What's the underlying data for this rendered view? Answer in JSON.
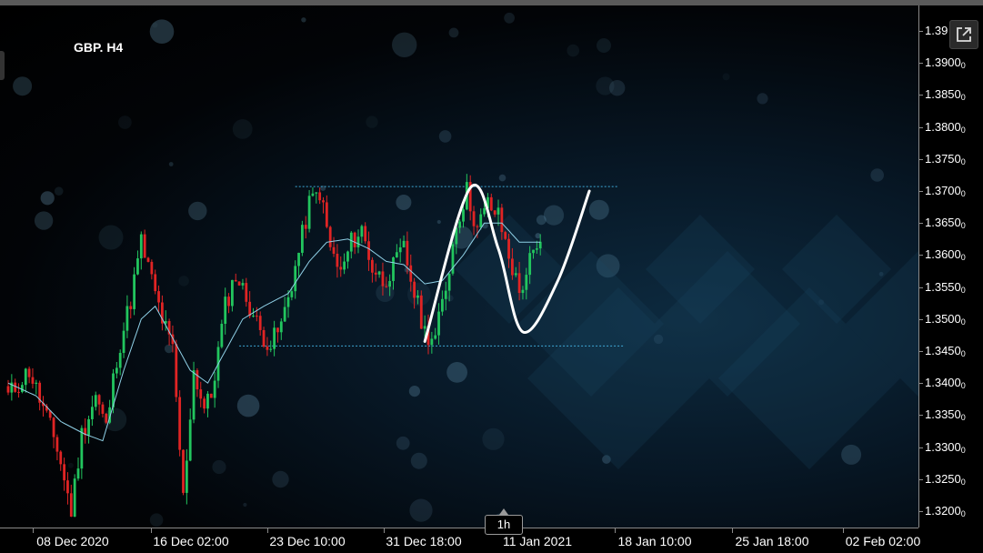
{
  "chart_data": {
    "type": "candlestick",
    "title": "GBP. H4",
    "timeframe": "1h",
    "ylim": [
      1.318,
      1.394
    ],
    "y_ticks": [
      1.395,
      1.39,
      1.385,
      1.38,
      1.375,
      1.37,
      1.365,
      1.36,
      1.355,
      1.35,
      1.345,
      1.34,
      1.335,
      1.33,
      1.325,
      1.32
    ],
    "y_tick_labels": [
      "1.39",
      "1.3900",
      "1.3850",
      "1.3800",
      "1.3750",
      "1.3700",
      "1.3650",
      "1.3600",
      "1.3550",
      "1.3500",
      "1.3450",
      "1.3400",
      "1.3350",
      "1.3300",
      "1.3250",
      "1.3200"
    ],
    "y_tick_suffix": "0",
    "x_tick_labels": [
      "08 Dec 2020",
      "16 Dec 02:00",
      "23 Dec 10:00",
      "31 Dec 18:00",
      "11 Jan 2021",
      "18 Jan 10:00",
      "25 Jan 18:00",
      "02 Feb 02:00"
    ],
    "bar_count": 164,
    "series": [
      {
        "name": "",
        "ohlc_anchors": [
          [
            0,
            1.338
          ],
          [
            6,
            1.342
          ],
          [
            10,
            1.336
          ],
          [
            14,
            1.33
          ],
          [
            18,
            1.32
          ],
          [
            21,
            1.332
          ],
          [
            25,
            1.338
          ],
          [
            28,
            1.333
          ],
          [
            31,
            1.344
          ],
          [
            35,
            1.353
          ],
          [
            38,
            1.362
          ],
          [
            41,
            1.356
          ],
          [
            44,
            1.35
          ],
          [
            47,
            1.345
          ],
          [
            50,
            1.322
          ],
          [
            53,
            1.342
          ],
          [
            56,
            1.336
          ],
          [
            58,
            1.338
          ],
          [
            62,
            1.352
          ],
          [
            65,
            1.357
          ],
          [
            69,
            1.352
          ],
          [
            72,
            1.348
          ],
          [
            75,
            1.346
          ],
          [
            78,
            1.349
          ],
          [
            82,
            1.358
          ],
          [
            86,
            1.368
          ],
          [
            89,
            1.37
          ],
          [
            92,
            1.361
          ],
          [
            95,
            1.357
          ],
          [
            98,
            1.362
          ],
          [
            101,
            1.364
          ],
          [
            104,
            1.358
          ],
          [
            107,
            1.356
          ],
          [
            110,
            1.358
          ],
          [
            113,
            1.361
          ],
          [
            116,
            1.354
          ],
          [
            119,
            1.348
          ],
          [
            122,
            1.347
          ],
          [
            125,
            1.355
          ],
          [
            128,
            1.365
          ],
          [
            131,
            1.37
          ],
          [
            134,
            1.364
          ],
          [
            137,
            1.368
          ],
          [
            140,
            1.366
          ],
          [
            143,
            1.36
          ],
          [
            146,
            1.354
          ],
          [
            149,
            1.359
          ],
          [
            152,
            1.361
          ]
        ],
        "moving_average_anchors": [
          [
            0,
            1.34
          ],
          [
            8,
            1.338
          ],
          [
            15,
            1.334
          ],
          [
            22,
            1.332
          ],
          [
            27,
            1.331
          ],
          [
            33,
            1.342
          ],
          [
            38,
            1.35
          ],
          [
            42,
            1.352
          ],
          [
            47,
            1.347
          ],
          [
            52,
            1.342
          ],
          [
            57,
            1.34
          ],
          [
            62,
            1.345
          ],
          [
            67,
            1.35
          ],
          [
            73,
            1.352
          ],
          [
            80,
            1.354
          ],
          [
            86,
            1.359
          ],
          [
            91,
            1.362
          ],
          [
            97,
            1.3625
          ],
          [
            103,
            1.361
          ],
          [
            108,
            1.359
          ],
          [
            113,
            1.3585
          ],
          [
            119,
            1.3555
          ],
          [
            124,
            1.356
          ],
          [
            130,
            1.36
          ],
          [
            136,
            1.365
          ],
          [
            141,
            1.365
          ],
          [
            146,
            1.362
          ],
          [
            152,
            1.362
          ]
        ]
      }
    ],
    "horizontal_lines": [
      {
        "name": "resistance",
        "value": 1.3707,
        "from_bar": 82,
        "to_bar": 174,
        "color": "#3fa9d6"
      },
      {
        "name": "support",
        "value": 1.3458,
        "from_bar": 66,
        "to_bar": 176,
        "color": "#3fa9d6"
      }
    ],
    "projection_path": {
      "color": "#ffffff",
      "points": [
        [
          119,
          1.3465
        ],
        [
          132,
          1.3705
        ],
        [
          140,
          1.361
        ],
        [
          147,
          1.348
        ],
        [
          157,
          1.356
        ],
        [
          166,
          1.37
        ]
      ]
    },
    "colors": {
      "up": "#22c55e",
      "down": "#e02424",
      "ma": "#8fd0e6",
      "axis_text": "#ffffff"
    }
  }
}
